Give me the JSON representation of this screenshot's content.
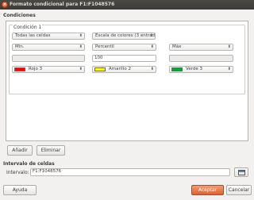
{
  "window": {
    "title": "Formato condicional para F1:F1048576",
    "close_label": "×"
  },
  "conditions": {
    "section_label": "Condiciones",
    "condition_title": "Condición 1",
    "applies_to": "Todas las celdas",
    "format_style": "Escala de colores (3 entradas)",
    "entries": [
      {
        "type": "Mín.",
        "value": "",
        "value_enabled": false,
        "color_name": "Rojo 3",
        "color": "#ff0000"
      },
      {
        "type": "Percentil",
        "value": "100",
        "value_enabled": true,
        "color_name": "Amarillo 2",
        "color": "#ffff00"
      },
      {
        "type": "Máx",
        "value": "",
        "value_enabled": false,
        "color_name": "Verde 3",
        "color": "#00a933"
      }
    ]
  },
  "buttons": {
    "add": "Añadir",
    "remove": "Eliminar",
    "help": "Ayuda",
    "accept": "Aceptar",
    "cancel": "Cancelar"
  },
  "range": {
    "section_label": "Intervalo de celdas",
    "field_label": "Intervalo:",
    "value": "F1:F1048576",
    "icon": "shrink-range-icon"
  },
  "colors": {
    "accent": "#e0622f",
    "titlebar": "#3c3b37"
  }
}
